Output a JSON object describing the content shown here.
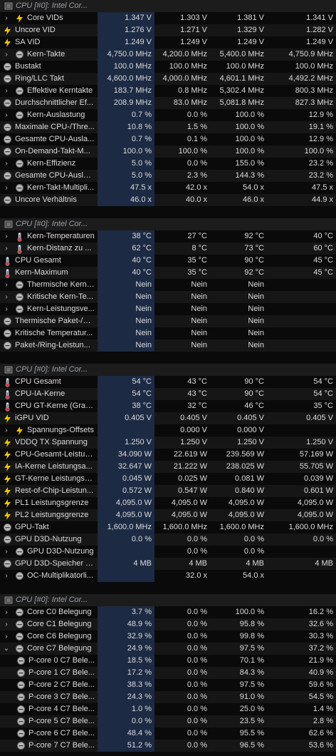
{
  "sections": [
    {
      "header": "CPU [#0]: Intel Cor...",
      "rows": [
        {
          "label": "Core VIDs",
          "icon": "bolt-icon",
          "expand": true,
          "v": [
            "1.347 V",
            "1.303 V",
            "1.381 V",
            "1.341 V"
          ]
        },
        {
          "label": "Uncore VID",
          "icon": "bolt-icon",
          "expand": false,
          "v": [
            "1.276 V",
            "1.271 V",
            "1.329 V",
            "1.282 V"
          ]
        },
        {
          "label": "SA VID",
          "icon": "bolt-icon",
          "expand": false,
          "v": [
            "1.249 V",
            "1.249 V",
            "1.249 V",
            "1.249 V"
          ]
        },
        {
          "label": "Kern-Takte",
          "icon": "clock-icon",
          "expand": true,
          "v": [
            "4,750.0 MHz",
            "4,200.0 MHz",
            "5,400.0 MHz",
            "4,750.9 MHz"
          ]
        },
        {
          "label": "Bustakt",
          "icon": "clock-icon",
          "expand": false,
          "v": [
            "100.0 MHz",
            "100.0 MHz",
            "100.0 MHz",
            "100.0 MHz"
          ]
        },
        {
          "label": "Ring/LLC Takt",
          "icon": "clock-icon",
          "expand": false,
          "v": [
            "4,600.0 MHz",
            "4,000.0 MHz",
            "4,601.1 MHz",
            "4,492.2 MHz"
          ]
        },
        {
          "label": "Effektive Kerntakte",
          "icon": "clock-icon",
          "expand": true,
          "v": [
            "183.7 MHz",
            "0.8 MHz",
            "5,302.4 MHz",
            "800.3 MHz"
          ]
        },
        {
          "label": "Durchschnittlicher Ef...",
          "icon": "clock-icon",
          "expand": false,
          "v": [
            "208.9 MHz",
            "83.0 MHz",
            "5,081.8 MHz",
            "827.3 MHz"
          ]
        },
        {
          "label": "Kern-Auslastung",
          "icon": "clock-icon",
          "expand": true,
          "v": [
            "0.7 %",
            "0.0 %",
            "100.0 %",
            "12.9 %"
          ]
        },
        {
          "label": "Maximale CPU-/Thre...",
          "icon": "clock-icon",
          "expand": false,
          "v": [
            "10.8 %",
            "1.5 %",
            "100.0 %",
            "19.1 %"
          ]
        },
        {
          "label": "Gesamte CPU-Ausla...",
          "icon": "clock-icon",
          "expand": false,
          "v": [
            "0.7 %",
            "0.1 %",
            "100.0 %",
            "12.9 %"
          ]
        },
        {
          "label": "On-Demand-Takt-M...",
          "icon": "clock-icon",
          "expand": false,
          "v": [
            "100.0 %",
            "100.0 %",
            "100.0 %",
            "100.0 %"
          ]
        },
        {
          "label": "Kern-Effizienz",
          "icon": "clock-icon",
          "expand": true,
          "v": [
            "5.0 %",
            "0.0 %",
            "155.0 %",
            "23.2 %"
          ]
        },
        {
          "label": "Gesamte CPU-Auslas...",
          "icon": "clock-icon",
          "expand": false,
          "v": [
            "5.0 %",
            "2.3 %",
            "144.3 %",
            "23.2 %"
          ]
        },
        {
          "label": "Kern-Takt-Multipli...",
          "icon": "clock-icon",
          "expand": true,
          "v": [
            "47.5 x",
            "42.0 x",
            "54.0 x",
            "47.5 x"
          ]
        },
        {
          "label": "Uncore Verhältnis",
          "icon": "clock-icon",
          "expand": false,
          "v": [
            "46.0 x",
            "40.0 x",
            "46.0 x",
            "44.9 x"
          ]
        }
      ]
    },
    {
      "header": "CPU [#0]: Intel Cor...",
      "rows": [
        {
          "label": "Kern-Temperaturen",
          "icon": "thermometer-icon",
          "expand": true,
          "v": [
            "38 °C",
            "27 °C",
            "92 °C",
            "40 °C"
          ]
        },
        {
          "label": "Kern-Distanz zu ...",
          "icon": "thermometer-icon",
          "expand": true,
          "v": [
            "62 °C",
            "8 °C",
            "73 °C",
            "60 °C"
          ]
        },
        {
          "label": "CPU Gesamt",
          "icon": "thermometer-icon",
          "expand": false,
          "v": [
            "40 °C",
            "35 °C",
            "90 °C",
            "45 °C"
          ]
        },
        {
          "label": "Kern-Maximum",
          "icon": "thermometer-icon",
          "expand": false,
          "v": [
            "40 °C",
            "35 °C",
            "92 °C",
            "45 °C"
          ]
        },
        {
          "label": "Thermische Kern-...",
          "icon": "clock-icon",
          "expand": true,
          "v": [
            "Nein",
            "Nein",
            "Nein",
            ""
          ]
        },
        {
          "label": "Kritische Kern-Te...",
          "icon": "clock-icon",
          "expand": true,
          "v": [
            "Nein",
            "Nein",
            "Nein",
            ""
          ]
        },
        {
          "label": "Kern-Leistungsve...",
          "icon": "clock-icon",
          "expand": true,
          "v": [
            "Nein",
            "Nein",
            "Nein",
            ""
          ]
        },
        {
          "label": "Thermische Paket-/R...",
          "icon": "clock-icon",
          "expand": false,
          "v": [
            "Nein",
            "Nein",
            "Nein",
            ""
          ]
        },
        {
          "label": "Kritische Temperatur...",
          "icon": "clock-icon",
          "expand": false,
          "v": [
            "Nein",
            "Nein",
            "Nein",
            ""
          ]
        },
        {
          "label": "Paket-/Ring-Leistun...",
          "icon": "clock-icon",
          "expand": false,
          "v": [
            "Nein",
            "Nein",
            "Nein",
            ""
          ]
        }
      ]
    },
    {
      "header": "CPU [#0]: Intel Cor...",
      "rows": [
        {
          "label": "CPU Gesamt",
          "icon": "thermometer-icon",
          "expand": false,
          "v": [
            "54 °C",
            "43 °C",
            "90 °C",
            "54 °C"
          ]
        },
        {
          "label": "CPU-IA-Kerne",
          "icon": "thermometer-icon",
          "expand": false,
          "v": [
            "54 °C",
            "43 °C",
            "90 °C",
            "54 °C"
          ]
        },
        {
          "label": "CPU GT-Kerne (Grafik)",
          "icon": "thermometer-icon",
          "expand": false,
          "v": [
            "38 °C",
            "32 °C",
            "46 °C",
            "35 °C"
          ]
        },
        {
          "label": "iGPU VID",
          "icon": "bolt-icon",
          "expand": false,
          "v": [
            "0.405 V",
            "0.405 V",
            "0.405 V",
            "0.405 V"
          ]
        },
        {
          "label": "Spannungs-Offsets",
          "icon": "bolt-icon",
          "expand": true,
          "v": [
            "",
            "0.000 V",
            "0.000 V",
            ""
          ]
        },
        {
          "label": "VDDQ TX Spannung",
          "icon": "bolt-icon",
          "expand": false,
          "v": [
            "1.250 V",
            "1.250 V",
            "1.250 V",
            "1.250 V"
          ]
        },
        {
          "label": "CPU-Gesamt-Leistun...",
          "icon": "bolt-icon",
          "expand": false,
          "v": [
            "34.090 W",
            "22.619 W",
            "239.569 W",
            "57.169 W"
          ]
        },
        {
          "label": "IA-Kerne Leistungsa...",
          "icon": "bolt-icon",
          "expand": false,
          "v": [
            "32.647 W",
            "21.222 W",
            "238.025 W",
            "55.705 W"
          ]
        },
        {
          "label": "GT-Kerne Leistungsa...",
          "icon": "bolt-icon",
          "expand": false,
          "v": [
            "0.045 W",
            "0.025 W",
            "0.081 W",
            "0.039 W"
          ]
        },
        {
          "label": "Rest-of-Chip-Leistun...",
          "icon": "bolt-icon",
          "expand": false,
          "v": [
            "0.572 W",
            "0.547 W",
            "0.840 W",
            "0.601 W"
          ]
        },
        {
          "label": "PL1 Leistungsgrenze",
          "icon": "bolt-icon",
          "expand": false,
          "v": [
            "4,095.0 W",
            "4,095.0 W",
            "4,095.0 W",
            "4,095.0 W"
          ]
        },
        {
          "label": "PL2 Leistungsgrenze",
          "icon": "bolt-icon",
          "expand": false,
          "v": [
            "4,095.0 W",
            "4,095.0 W",
            "4,095.0 W",
            "4,095.0 W"
          ]
        },
        {
          "label": "GPU-Takt",
          "icon": "clock-icon",
          "expand": false,
          "v": [
            "1,600.0 MHz",
            "1,600.0 MHz",
            "1,600.0 MHz",
            "1,600.0 MHz"
          ]
        },
        {
          "label": "GPU D3D-Nutzung",
          "icon": "clock-icon",
          "expand": false,
          "v": [
            "0.0 %",
            "0.0 %",
            "0.0 %",
            "0.0 %"
          ]
        },
        {
          "label": "GPU D3D-Nutzung",
          "icon": "clock-icon",
          "expand": true,
          "v": [
            "",
            "0.0 %",
            "0.0 %",
            ""
          ]
        },
        {
          "label": "GPU D3D-Speicher d...",
          "icon": "clock-icon",
          "expand": false,
          "v": [
            "4 MB",
            "4 MB",
            "4 MB",
            "4 MB"
          ]
        },
        {
          "label": "OC-Multiplikatorli...",
          "icon": "clock-icon",
          "expand": true,
          "v": [
            "",
            "32.0 x",
            "54.0 x",
            ""
          ]
        }
      ]
    },
    {
      "header": "CPU [#0]: Intel Cor...",
      "rows": [
        {
          "label": "Core C0 Belegung",
          "icon": "clock-icon",
          "expand": true,
          "v": [
            "3.7 %",
            "0.0 %",
            "100.0 %",
            "16.2 %"
          ]
        },
        {
          "label": "Core C1 Belegung",
          "icon": "clock-icon",
          "expand": true,
          "v": [
            "48.9 %",
            "0.0 %",
            "95.8 %",
            "32.6 %"
          ]
        },
        {
          "label": "Core C6 Belegung",
          "icon": "clock-icon",
          "expand": true,
          "v": [
            "32.9 %",
            "0.0 %",
            "99.8 %",
            "30.3 %"
          ]
        },
        {
          "label": "Core C7 Belegung",
          "icon": "clock-icon",
          "expand": "open",
          "v": [
            "24.9 %",
            "0.0 %",
            "97.5 %",
            "37.2 %"
          ]
        },
        {
          "label": "P-core 0 C7 Bele...",
          "icon": "clock-icon",
          "child": true,
          "v": [
            "18.5 %",
            "0.0 %",
            "70.1 %",
            "21.9 %"
          ]
        },
        {
          "label": "P-core 1 C7 Bele...",
          "icon": "clock-icon",
          "child": true,
          "v": [
            "17.2 %",
            "0.0 %",
            "84.3 %",
            "40.9 %"
          ]
        },
        {
          "label": "P-core 2 C7 Bele...",
          "icon": "clock-icon",
          "child": true,
          "v": [
            "38.3 %",
            "0.0 %",
            "97.5 %",
            "59.6 %"
          ]
        },
        {
          "label": "P-core 3 C7 Bele...",
          "icon": "clock-icon",
          "child": true,
          "v": [
            "24.3 %",
            "0.0 %",
            "91.0 %",
            "54.5 %"
          ]
        },
        {
          "label": "P-core 4 C7 Bele...",
          "icon": "clock-icon",
          "child": true,
          "v": [
            "1.0 %",
            "0.0 %",
            "25.0 %",
            "1.4 %"
          ]
        },
        {
          "label": "P-core 5 C7 Bele...",
          "icon": "clock-icon",
          "child": true,
          "v": [
            "0.0 %",
            "0.0 %",
            "23.5 %",
            "2.8 %"
          ]
        },
        {
          "label": "P-core 6 C7 Bele...",
          "icon": "clock-icon",
          "child": true,
          "v": [
            "48.4 %",
            "0.0 %",
            "95.5 %",
            "62.6 %"
          ]
        },
        {
          "label": "P-core 7 C7 Bele...",
          "icon": "clock-icon",
          "child": true,
          "v": [
            "51.2 %",
            "0.0 %",
            "96.5 %",
            "53.6 %"
          ]
        }
      ]
    }
  ]
}
